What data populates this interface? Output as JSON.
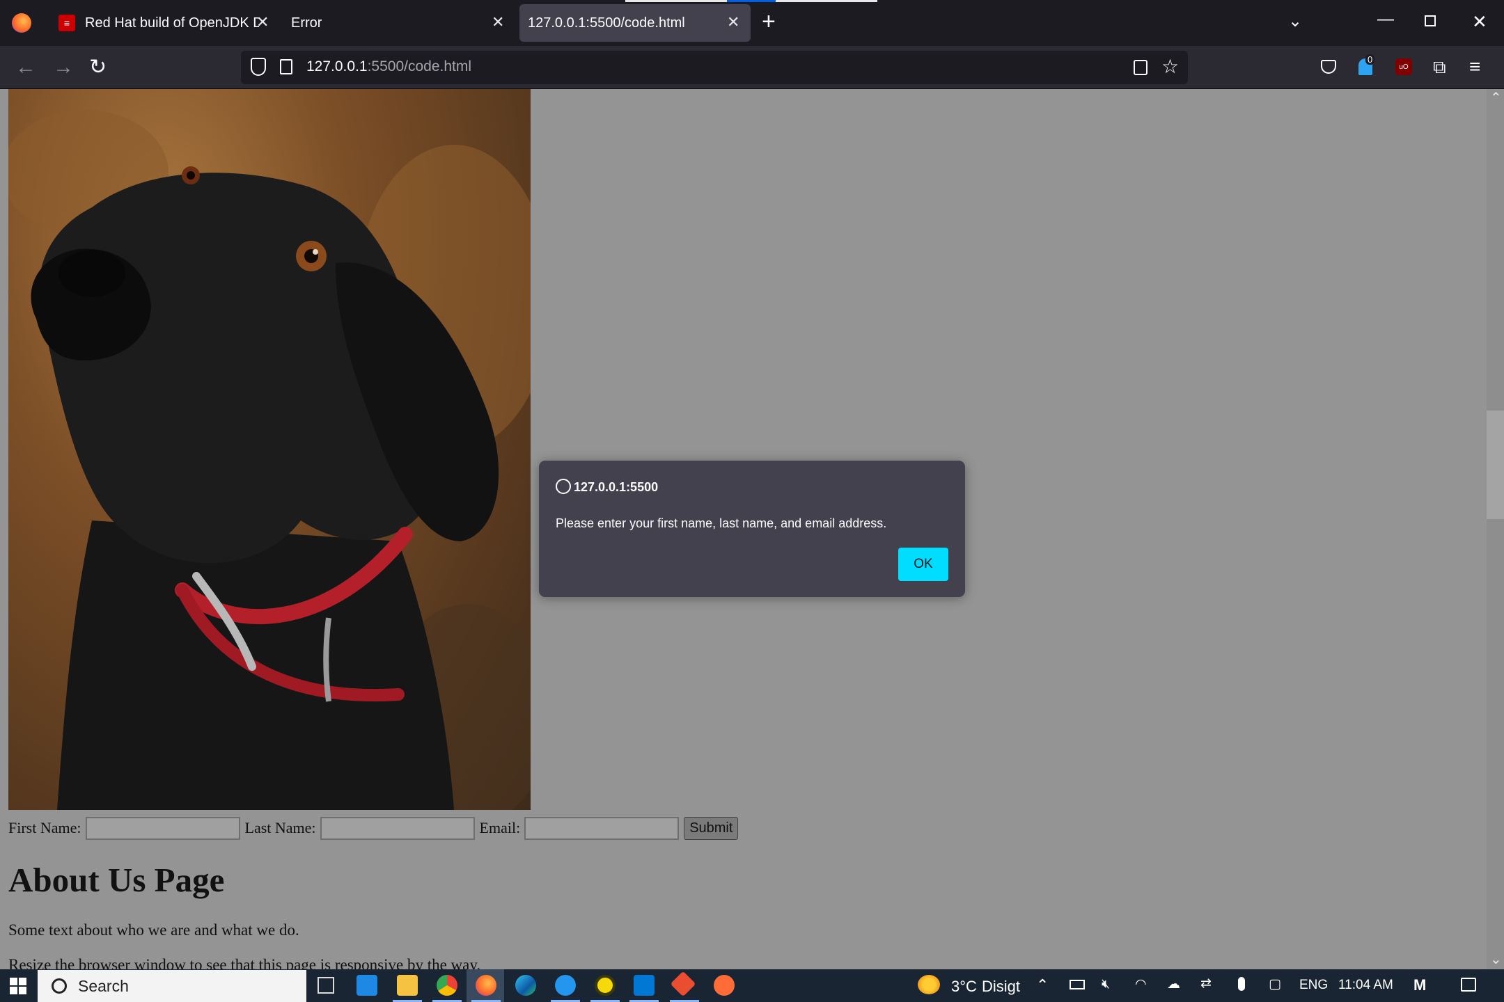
{
  "browser": {
    "tabs": [
      {
        "title": "Red Hat build of OpenJDK Down",
        "favicon": "redhat-icon"
      },
      {
        "title": "Error"
      },
      {
        "title": "127.0.0.1:5500/code.html",
        "active": true
      }
    ],
    "url": {
      "host": "127.0.0.1",
      "rest": ":5500/code.html"
    },
    "extension_badge": "0"
  },
  "page": {
    "form": {
      "first_label": "First Name:",
      "last_label": "Last Name:",
      "email_label": "Email:",
      "submit_label": "Submit"
    },
    "heading": "About Us Page",
    "para1": "Some text about who we are and what we do.",
    "para2": "Resize the browser window to see that this page is responsive by the way."
  },
  "dialog": {
    "origin": "127.0.0.1:5500",
    "message": "Please enter your first name, last name, and email address.",
    "ok_label": "OK"
  },
  "taskbar": {
    "search_label": "Search",
    "weather": "3°C",
    "weather_desc": "Disigt",
    "language": "ENG",
    "time": "11:04 AM"
  },
  "colors": {
    "accent": "#00ddff",
    "chrome_dark": "#1c1b22",
    "dialog_bg": "#42414d",
    "overlay": "#949494"
  }
}
